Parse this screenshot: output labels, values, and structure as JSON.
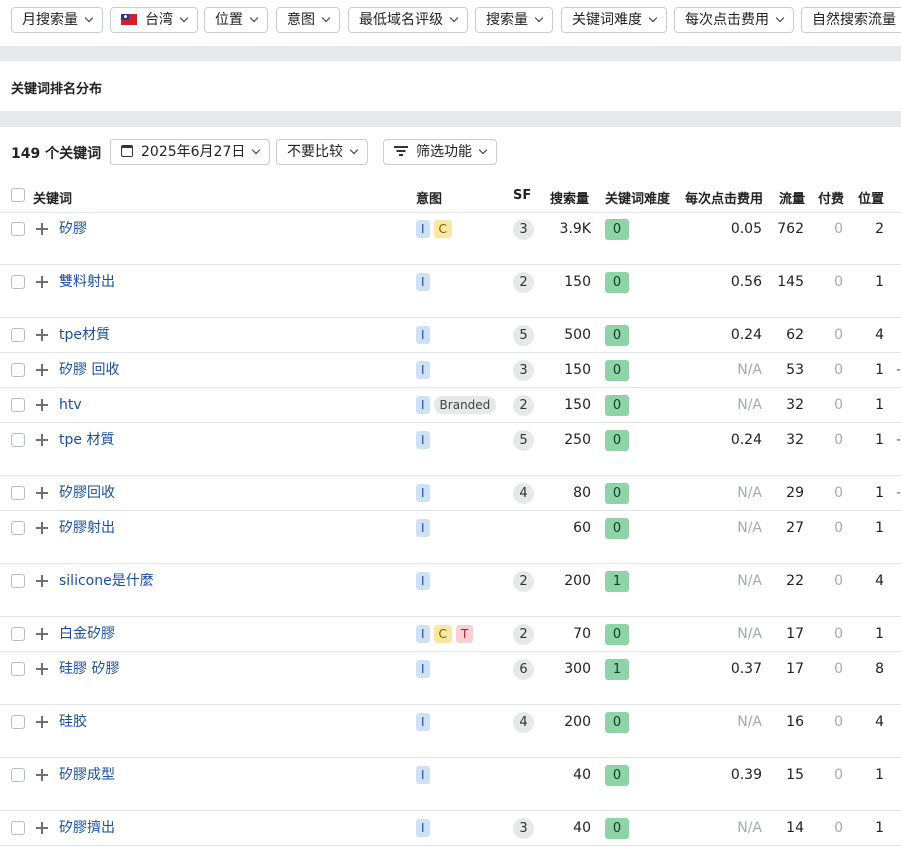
{
  "filters": [
    {
      "label": "月搜索量"
    },
    {
      "label": "台湾",
      "flag": true
    },
    {
      "label": "位置"
    },
    {
      "label": "意图"
    },
    {
      "label": "最低域名评级"
    },
    {
      "label": "搜索量"
    },
    {
      "label": "关键词难度"
    },
    {
      "label": "每次点击费用"
    },
    {
      "label": "自然搜索流量"
    }
  ],
  "section_title": "关键词排名分布",
  "controls": {
    "count": "149 个关键词",
    "date": "2025年6月27日",
    "compare": "不要比较",
    "filter": "筛选功能"
  },
  "columns": {
    "keyword": "关键词",
    "intent": "意图",
    "sf": "SF",
    "volume": "搜索量",
    "kd": "关键词难度",
    "cpc": "每次点击费用",
    "traffic": "流量",
    "paid": "付费",
    "position": "位置"
  },
  "colors": {
    "kd_low": "#8fd4a9",
    "link": "#1a4f9c"
  },
  "rows": [
    {
      "keyword": "矽膠",
      "intents": [
        "I",
        "C"
      ],
      "sf": "3",
      "volume": "3.9K",
      "kd": "0",
      "cpc": "0.05",
      "traffic": "762",
      "paid": "0",
      "position": "2",
      "tall": true,
      "trend": false
    },
    {
      "keyword": "雙料射出",
      "intents": [
        "I"
      ],
      "sf": "2",
      "volume": "150",
      "kd": "0",
      "cpc": "0.56",
      "traffic": "145",
      "paid": "0",
      "position": "1",
      "tall": true,
      "trend": false
    },
    {
      "keyword": "tpe材質",
      "intents": [
        "I"
      ],
      "sf": "5",
      "volume": "500",
      "kd": "0",
      "cpc": "0.24",
      "traffic": "62",
      "paid": "0",
      "position": "4",
      "tall": false,
      "trend": false
    },
    {
      "keyword": "矽膠 回收",
      "intents": [
        "I"
      ],
      "sf": "3",
      "volume": "150",
      "kd": "0",
      "cpc": "N/A",
      "traffic": "53",
      "paid": "0",
      "position": "1",
      "tall": false,
      "trend": true
    },
    {
      "keyword": "htv",
      "intents": [
        "I",
        "Branded"
      ],
      "sf": "2",
      "volume": "150",
      "kd": "0",
      "cpc": "N/A",
      "traffic": "32",
      "paid": "0",
      "position": "1",
      "tall": false,
      "trend": false
    },
    {
      "keyword": "tpe 材質",
      "intents": [
        "I"
      ],
      "sf": "5",
      "volume": "250",
      "kd": "0",
      "cpc": "0.24",
      "traffic": "32",
      "paid": "0",
      "position": "1",
      "tall": true,
      "trend": true
    },
    {
      "keyword": "矽膠回收",
      "intents": [
        "I"
      ],
      "sf": "4",
      "volume": "80",
      "kd": "0",
      "cpc": "N/A",
      "traffic": "29",
      "paid": "0",
      "position": "1",
      "tall": false,
      "trend": true
    },
    {
      "keyword": "矽膠射出",
      "intents": [
        "I"
      ],
      "sf": "",
      "volume": "60",
      "kd": "0",
      "cpc": "N/A",
      "traffic": "27",
      "paid": "0",
      "position": "1",
      "tall": true,
      "trend": false
    },
    {
      "keyword": "silicone是什麼",
      "intents": [
        "I"
      ],
      "sf": "2",
      "volume": "200",
      "kd": "1",
      "cpc": "N/A",
      "traffic": "22",
      "paid": "0",
      "position": "4",
      "tall": true,
      "trend": false
    },
    {
      "keyword": "白金矽膠",
      "intents": [
        "I",
        "C",
        "T"
      ],
      "sf": "2",
      "volume": "70",
      "kd": "0",
      "cpc": "N/A",
      "traffic": "17",
      "paid": "0",
      "position": "1",
      "tall": false,
      "trend": false
    },
    {
      "keyword": "硅膠 矽膠",
      "intents": [
        "I"
      ],
      "sf": "6",
      "volume": "300",
      "kd": "1",
      "cpc": "0.37",
      "traffic": "17",
      "paid": "0",
      "position": "8",
      "tall": true,
      "trend": false
    },
    {
      "keyword": "硅胶",
      "intents": [
        "I"
      ],
      "sf": "4",
      "volume": "200",
      "kd": "0",
      "cpc": "N/A",
      "traffic": "16",
      "paid": "0",
      "position": "4",
      "tall": true,
      "trend": false
    },
    {
      "keyword": "矽膠成型",
      "intents": [
        "I"
      ],
      "sf": "",
      "volume": "40",
      "kd": "0",
      "cpc": "0.39",
      "traffic": "15",
      "paid": "0",
      "position": "1",
      "tall": true,
      "trend": false
    },
    {
      "keyword": "矽膠擠出",
      "intents": [
        "I"
      ],
      "sf": "3",
      "volume": "40",
      "kd": "0",
      "cpc": "N/A",
      "traffic": "14",
      "paid": "0",
      "position": "1",
      "tall": false,
      "trend": false
    }
  ]
}
